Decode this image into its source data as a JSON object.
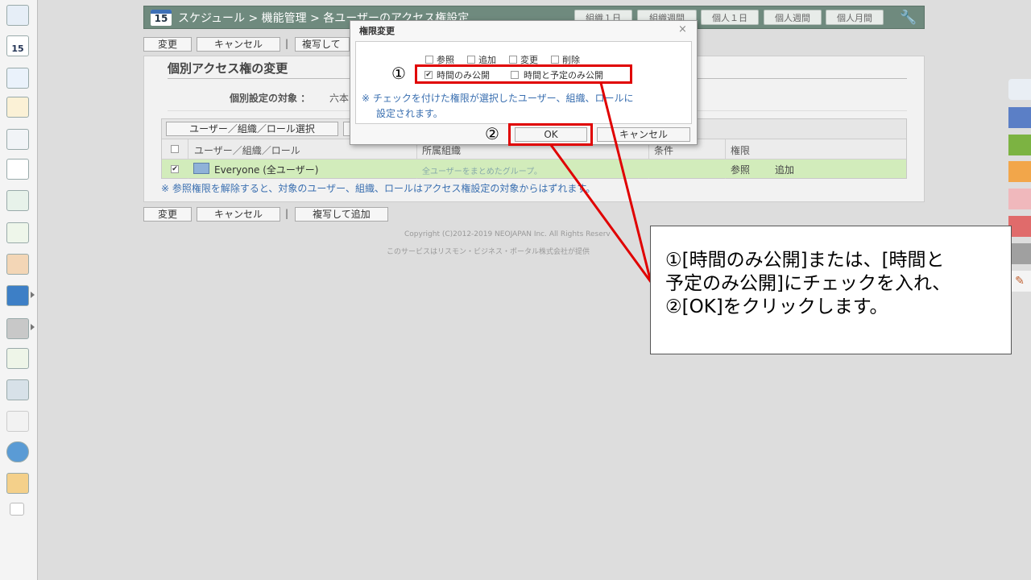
{
  "header": {
    "title": "スケジュール > 機能管理 > 各ユーザーのアクセス権設定",
    "calendar_day": "15",
    "view_buttons": [
      "組織１日",
      "組織週間",
      "個人１日",
      "個人週間",
      "個人月間"
    ]
  },
  "action_bar": {
    "change_label": "変更",
    "cancel_label": "キャンセル",
    "separator": "|",
    "copy_add_label": "複写して追加",
    "copy_add_partial": "複写して"
  },
  "panel": {
    "title": "個別アクセス権の変更",
    "target_label": "個別設定の対象 ：",
    "target_value": "六本",
    "select_button": "ユーザー／組織／ロール選択",
    "columns": [
      "ユーザー／組織／ロール",
      "所属組織",
      "条件",
      "権限"
    ],
    "rows": [
      {
        "name": "Everyone (全ユーザー)",
        "org": "全ユーザーをまとめたグループ。",
        "condition": "",
        "perm1": "参照",
        "perm2": "追加"
      }
    ],
    "note": "※ 参照権限を解除すると、対象のユーザー、組織、ロールはアクセス権設定の対象からはずれます。"
  },
  "footer": {
    "copyright": "Copyright (C)2012-2019 NEOJAPAN Inc. All Rights Reserv",
    "service": "このサービスはリスモン・ビジネス・ポータル株式会社が提供"
  },
  "dialog": {
    "title": "権限変更",
    "close_glyph": "×",
    "checkboxes_row1": [
      "参照",
      "追加",
      "変更",
      "削除"
    ],
    "time_only": "時間のみ公開",
    "time_and_plan": "時間と予定のみ公開",
    "note_line1": "※ チェックを付けた権限が選択したユーザー、組織、ロールに",
    "note_line2": "設定されます。",
    "ok_label": "OK",
    "cancel_label": "キャンセル"
  },
  "annotation": {
    "marker1": "①",
    "marker2": "②",
    "callout_line1": "①[時間のみ公開]または、[時間と",
    "callout_line2": "予定のみ公開]にチェックを入れ、",
    "callout_line3": "②[OK]をクリックします。"
  },
  "colors": {
    "header_bg": "#6f8a7e",
    "row_highlight": "#d2ecbb",
    "note_blue": "#3a6fb0",
    "annotation_red": "#e00000"
  },
  "icons": [
    "calendar-icon",
    "wrench-icon",
    "close-icon",
    "checkbox-icon",
    "group-icon"
  ]
}
